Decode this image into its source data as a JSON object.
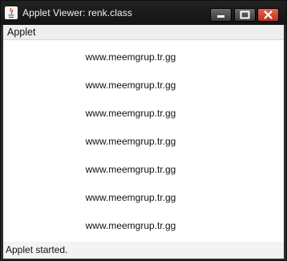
{
  "window": {
    "title": "Applet Viewer: renk.class",
    "icon": "java-icon",
    "controls": {
      "minimize": "minimize-icon",
      "maximize": "maximize-icon",
      "close": "close-icon"
    }
  },
  "menubar": {
    "items": [
      {
        "label": "Applet"
      }
    ]
  },
  "applet": {
    "lines": [
      "www.meemgrup.tr.gg",
      "www.meemgrup.tr.gg",
      "www.meemgrup.tr.gg",
      "www.meemgrup.tr.gg",
      "www.meemgrup.tr.gg",
      "www.meemgrup.tr.gg",
      "www.meemgrup.tr.gg"
    ]
  },
  "status": {
    "text": "Applet started."
  },
  "colors": {
    "close_button": "#c8442b",
    "titlebar": "#1b1b1b",
    "applet_background": "#ffffff"
  }
}
